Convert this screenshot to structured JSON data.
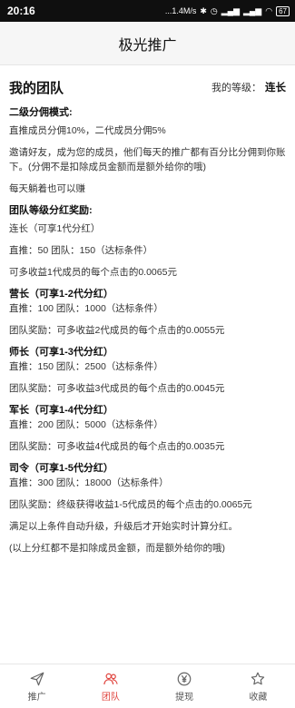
{
  "status": {
    "time": "20:16",
    "speed": "...1.4M/s",
    "battery": "67"
  },
  "appbar": {
    "title": "极光推广"
  },
  "team": {
    "title": "我的团队",
    "level_label": "我的等级：",
    "level_value": "连长"
  },
  "sections": {
    "mode_title": "二级分佣模式:",
    "mode_line": "直推成员分佣10%，二代成员分佣5%",
    "invite_text": "邀请好友，成为您的成员，他们每天的推广都有百分比分佣到你账下。(分佣不是扣除成员金额而是额外给你的哦)",
    "slogan": "每天躺着也可以赚",
    "team_title": "团队等级分红奖励:",
    "lianzhang_title": "连长（可享1代分红）",
    "lianzhang_cond": "直推：50 团队：150（达标条件）",
    "lianzhang_reward": "可多收益1代成员的每个点击的0.0065元",
    "yingzhang_title": "营长（可享1-2代分红）",
    "yingzhang_cond": "直推：100 团队：1000（达标条件）",
    "yingzhang_reward": "团队奖励：可多收益2代成员的每个点击的0.0055元",
    "shizhang_title": "师长（可享1-3代分红）",
    "shizhang_cond": "直推：150 团队：2500（达标条件）",
    "shizhang_reward": "团队奖励：可多收益3代成员的每个点击的0.0045元",
    "junzhang_title": "军长（可享1-4代分红）",
    "junzhang_cond": "直推：200 团队：5000（达标条件）",
    "junzhang_reward": "团队奖励：可多收益4代成员的每个点击的0.0035元",
    "siling_title": "司令（可享1-5代分红）",
    "siling_cond": "直推：300 团队：18000（达标条件）",
    "siling_reward": "团队奖励：终级获得收益1-5代成员的每个点击的0.0065元",
    "auto_upgrade": "满足以上条件自动升级，升级后才开始实时计算分红。",
    "note": "(以上分红都不是扣除成员金额，而是额外给你的哦)"
  },
  "tabs": [
    {
      "label": "推广",
      "icon": "send-icon"
    },
    {
      "label": "团队",
      "icon": "team-icon"
    },
    {
      "label": "提现",
      "icon": "yen-icon"
    },
    {
      "label": "收藏",
      "icon": "star-icon"
    }
  ],
  "colors": {
    "accent": "#e0443e",
    "statusbar": "#0f0f0f"
  }
}
